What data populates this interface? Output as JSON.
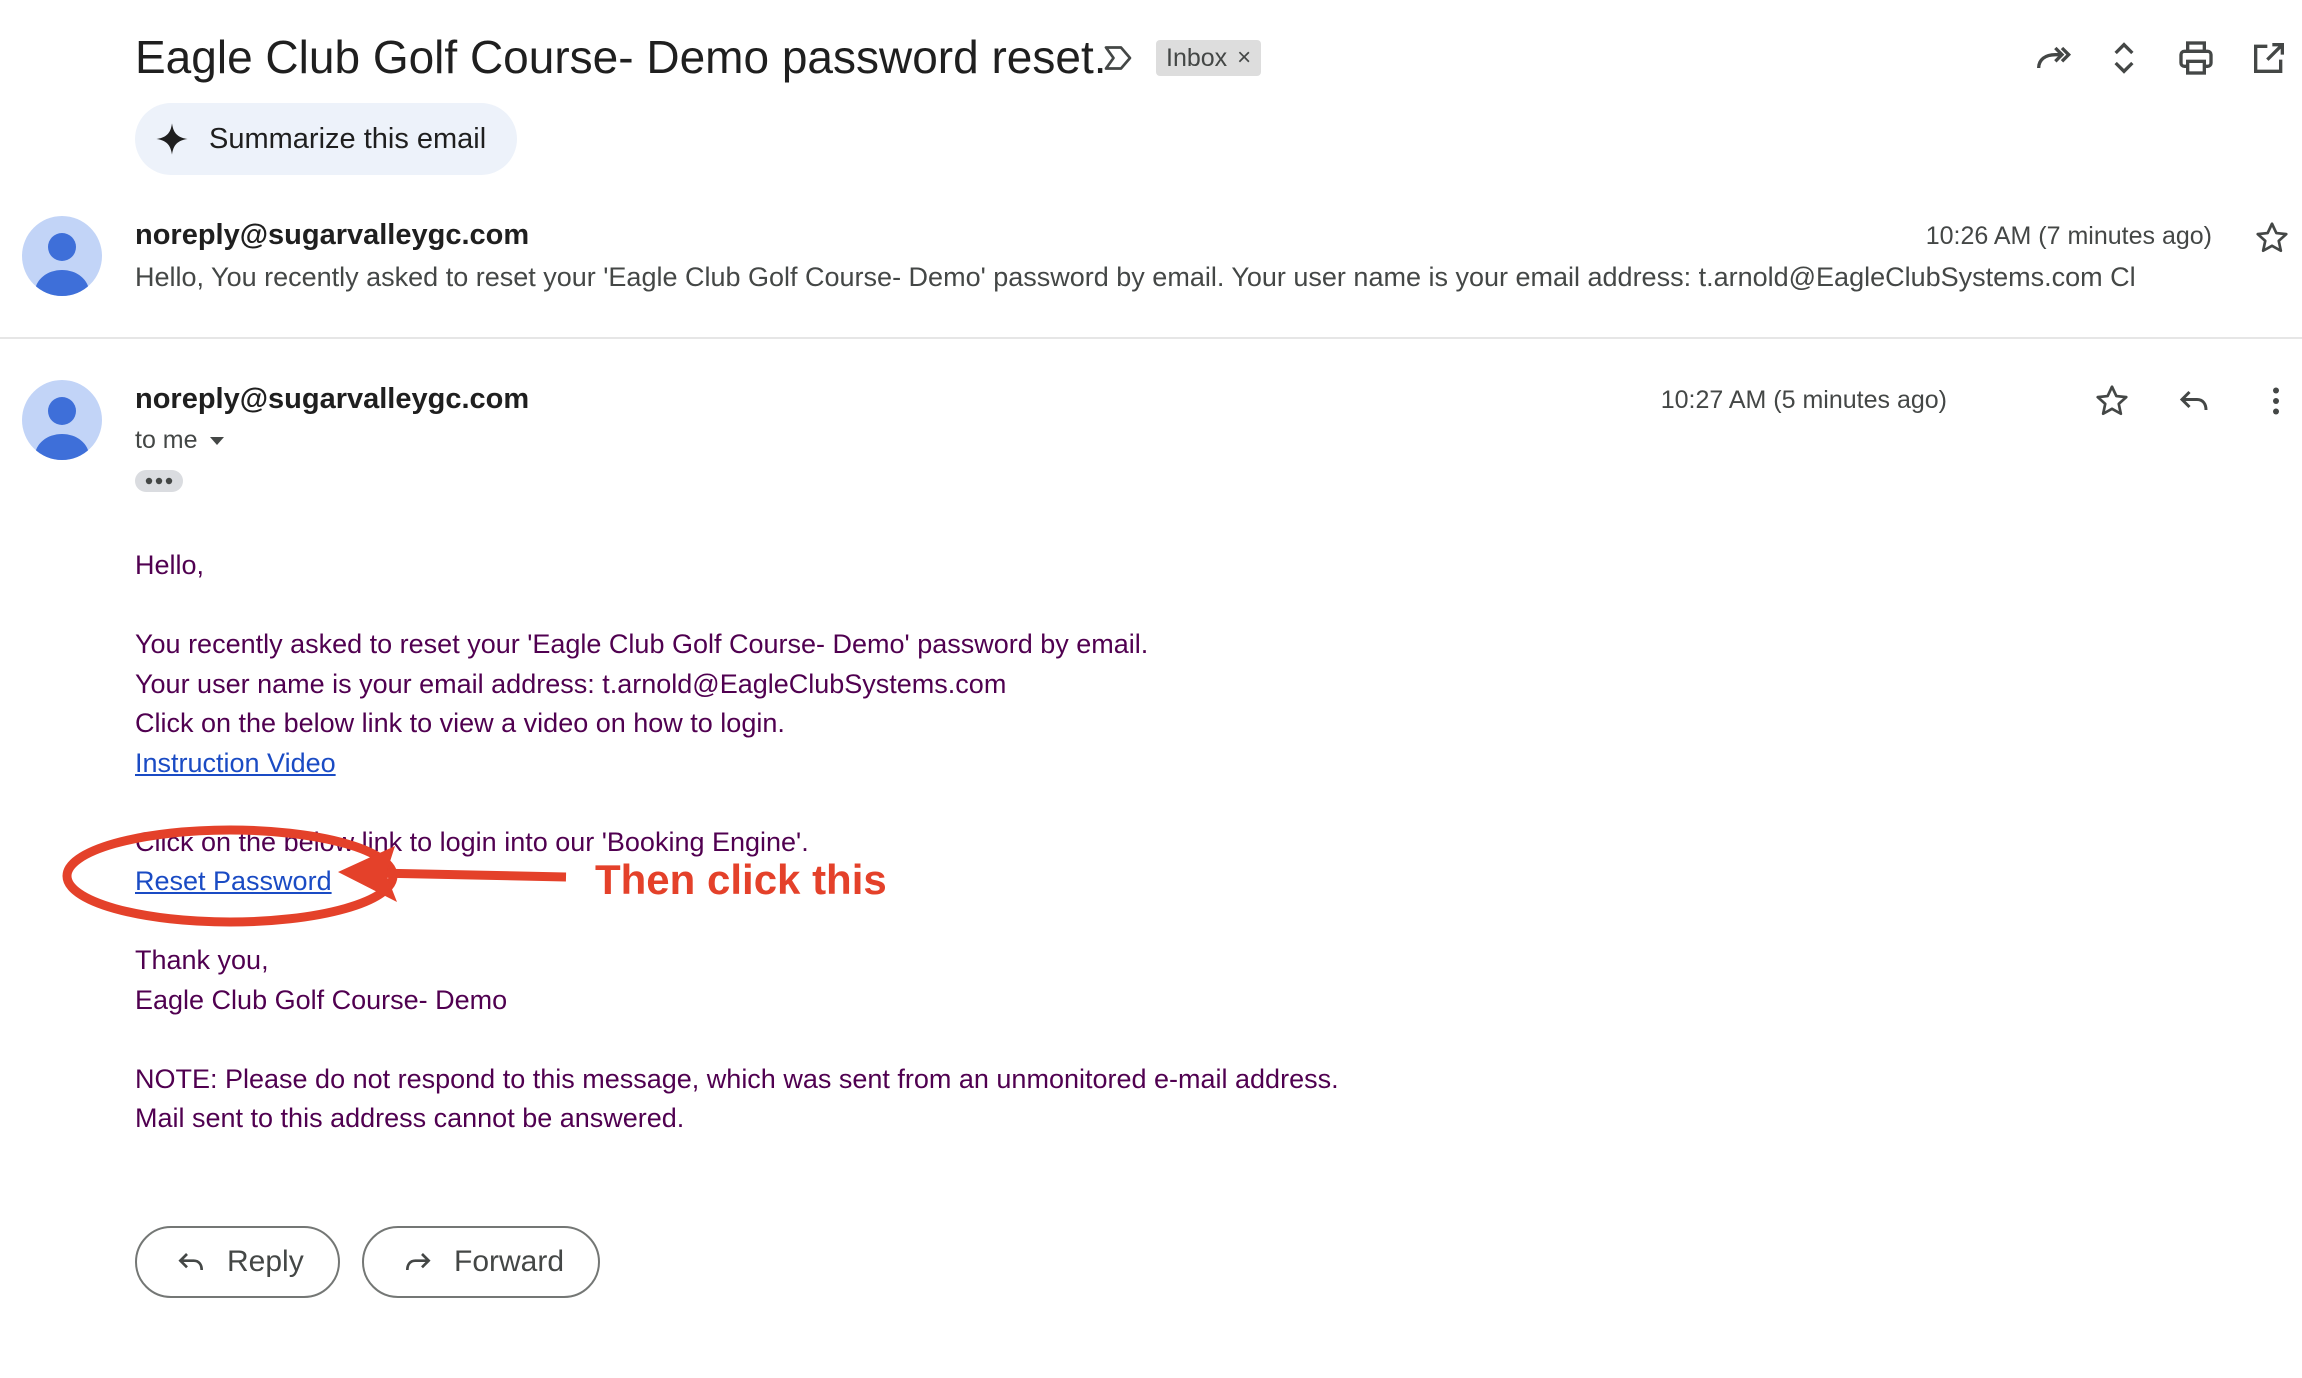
{
  "thread": {
    "subject": "Eagle Club Golf Course- Demo password reset.",
    "label_chip": "Inbox",
    "label_close": "×",
    "summarize_label": "Summarize this email"
  },
  "messages": [
    {
      "sender": "noreply@sugarvalleygc.com",
      "time": "10:26 AM (7 minutes ago)",
      "snippet": "Hello, You recently asked to reset your 'Eagle Club Golf Course- Demo' password by email. Your user name is your email address: t.arnold@EagleClubSystems.com Cl"
    },
    {
      "sender": "noreply@sugarvalleygc.com",
      "time": "10:27 AM (5 minutes ago)",
      "recipient": "to me",
      "body": {
        "greeting": "Hello,",
        "line1": "You recently asked to reset your 'Eagle Club Golf Course- Demo' password by email.",
        "line2": "Your user name is your email address: t.arnold@EagleClubSystems.com",
        "line3": "Click on the below link to view a video on how to login.",
        "video_link": "Instruction Video",
        "line4": "Click on the below link to login into our 'Booking Engine'.",
        "reset_link": "Reset Password",
        "thanks": "Thank you,",
        "signature": "Eagle Club Golf Course- Demo",
        "note1": "NOTE: Please do not respond to this message, which was sent from an unmonitored e-mail address.",
        "note2": "Mail sent to this address cannot be answered."
      }
    }
  ],
  "annotation": {
    "text": "Then click this",
    "color": "#e4412a"
  },
  "actions": {
    "reply": "Reply",
    "forward": "Forward"
  },
  "icons": [
    "label-icon",
    "forward-all-icon",
    "expand-collapse-icon",
    "print-icon",
    "open-new-window-icon",
    "sparkle-icon",
    "star-icon",
    "reply-icon",
    "more-vert-icon",
    "dropdown-arrow-icon",
    "ellipsis-icon",
    "forward-icon"
  ]
}
